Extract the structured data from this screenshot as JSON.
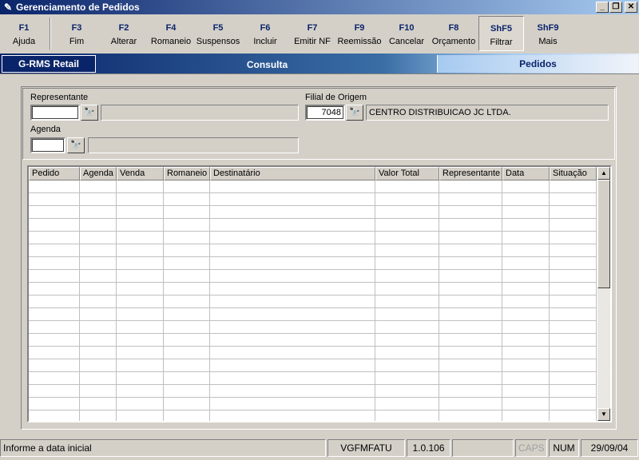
{
  "window": {
    "title": "Gerenciamento de Pedidos",
    "minimize": "_",
    "restore": "❐",
    "close": "✕"
  },
  "toolbar": [
    {
      "key": "F1",
      "label": "Ajuda"
    },
    {
      "key": "F3",
      "label": "Fim"
    },
    {
      "key": "F2",
      "label": "Alterar"
    },
    {
      "key": "F4",
      "label": "Romaneio"
    },
    {
      "key": "F5",
      "label": "Suspensos"
    },
    {
      "key": "F6",
      "label": "Incluir"
    },
    {
      "key": "F7",
      "label": "Emitir NF"
    },
    {
      "key": "F9",
      "label": "Reemissão"
    },
    {
      "key": "F10",
      "label": "Cancelar"
    },
    {
      "key": "F8",
      "label": "Orçamento"
    },
    {
      "key": "ShF5",
      "label": "Filtrar"
    },
    {
      "key": "ShF9",
      "label": "Mais"
    }
  ],
  "header": {
    "app": "G-RMS Retail",
    "mode": "Consulta",
    "module": "Pedidos"
  },
  "filters": {
    "representante_label": "Representante",
    "representante_value": "",
    "representante_desc": "",
    "agenda_label": "Agenda",
    "agenda_value": "",
    "agenda_desc": "",
    "filial_label": "Filial de Origem",
    "filial_value": "7048",
    "filial_desc": "CENTRO DISTRIBUICAO JC LTDA."
  },
  "grid": {
    "columns": [
      "Pedido",
      "Agenda",
      "Venda",
      "Romaneio",
      "Destinatário",
      "Valor Total",
      "Representante",
      "Data",
      "Situação"
    ],
    "rows": []
  },
  "status": {
    "message": "Informe a data inicial",
    "program": "VGFMFATU",
    "version": "1.0.106",
    "blank": "",
    "caps": "CAPS",
    "num": "NUM",
    "date": "29/09/04"
  }
}
